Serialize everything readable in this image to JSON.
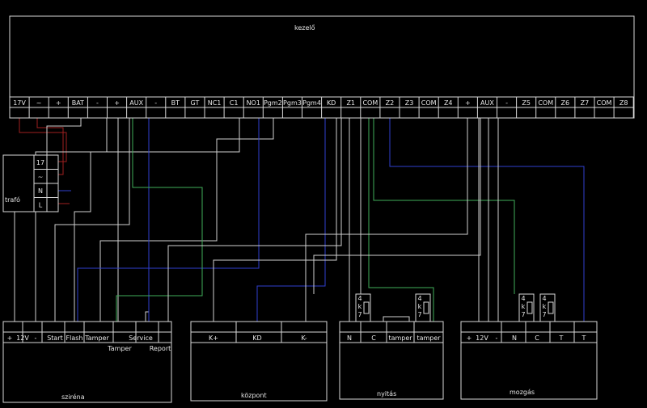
{
  "diagram": {
    "panel": {
      "title": "kezelő",
      "terminals": [
        "17V",
        "~",
        "+",
        "BAT",
        "-",
        "+",
        "AUX",
        "-",
        "BT",
        "GT",
        "NC1",
        "C1",
        "NO1",
        "Pgm2",
        "Pgm3",
        "Pgm4",
        "KD",
        "Z1",
        "COM",
        "Z2",
        "Z3",
        "COM",
        "Z4",
        "+",
        "AUX",
        "-",
        "Z5",
        "COM",
        "Z6",
        "Z7",
        "COM",
        "Z8"
      ]
    },
    "trafo": {
      "title": "trafó",
      "terminals": [
        "17",
        "~",
        "N",
        "L"
      ]
    },
    "sziren": {
      "title": "sziréna",
      "terminals": [
        "+",
        "12V",
        "-",
        "Start",
        "Flash",
        "Tamper",
        "Tamper",
        "Service",
        "Report"
      ]
    },
    "kozpont": {
      "title": "központ",
      "terminals": [
        "K+",
        "KD",
        "K-"
      ]
    },
    "nyitas": {
      "title": "nyitás",
      "terminals": [
        "N",
        "C",
        "tamper",
        "tamper"
      ],
      "resistor_labels": [
        "4",
        "k",
        "7",
        "4",
        "k",
        "7"
      ]
    },
    "mozgas": {
      "title": "mozgás",
      "terminals": [
        "+",
        "12V",
        "-",
        "N",
        "C",
        "T",
        "T"
      ],
      "resistor_labels": [
        "4",
        "k",
        "7",
        "4",
        "k",
        "7"
      ]
    },
    "wire_colors": {
      "white": "#d0d0d0",
      "blue": "#2f3fd0",
      "green": "#3fae5a",
      "red": "#a02020"
    }
  }
}
